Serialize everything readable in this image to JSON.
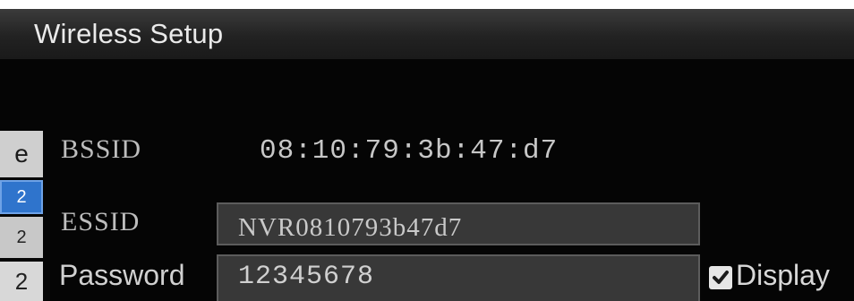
{
  "window": {
    "title": "Wireless Setup"
  },
  "tabs": [
    "e",
    "2",
    "2",
    "2"
  ],
  "bssid": {
    "label": "BSSID",
    "value": "08:10:79:3b:47:d7"
  },
  "essid": {
    "label": "ESSID",
    "value": "NVR0810793b47d7"
  },
  "password": {
    "label": "Password",
    "value": "12345678"
  },
  "display": {
    "label": "Display",
    "checked": true
  },
  "colors": {
    "tab_active": "#2f74cc",
    "field_bg": "#383838",
    "title_bg": "#2a2a2a"
  }
}
